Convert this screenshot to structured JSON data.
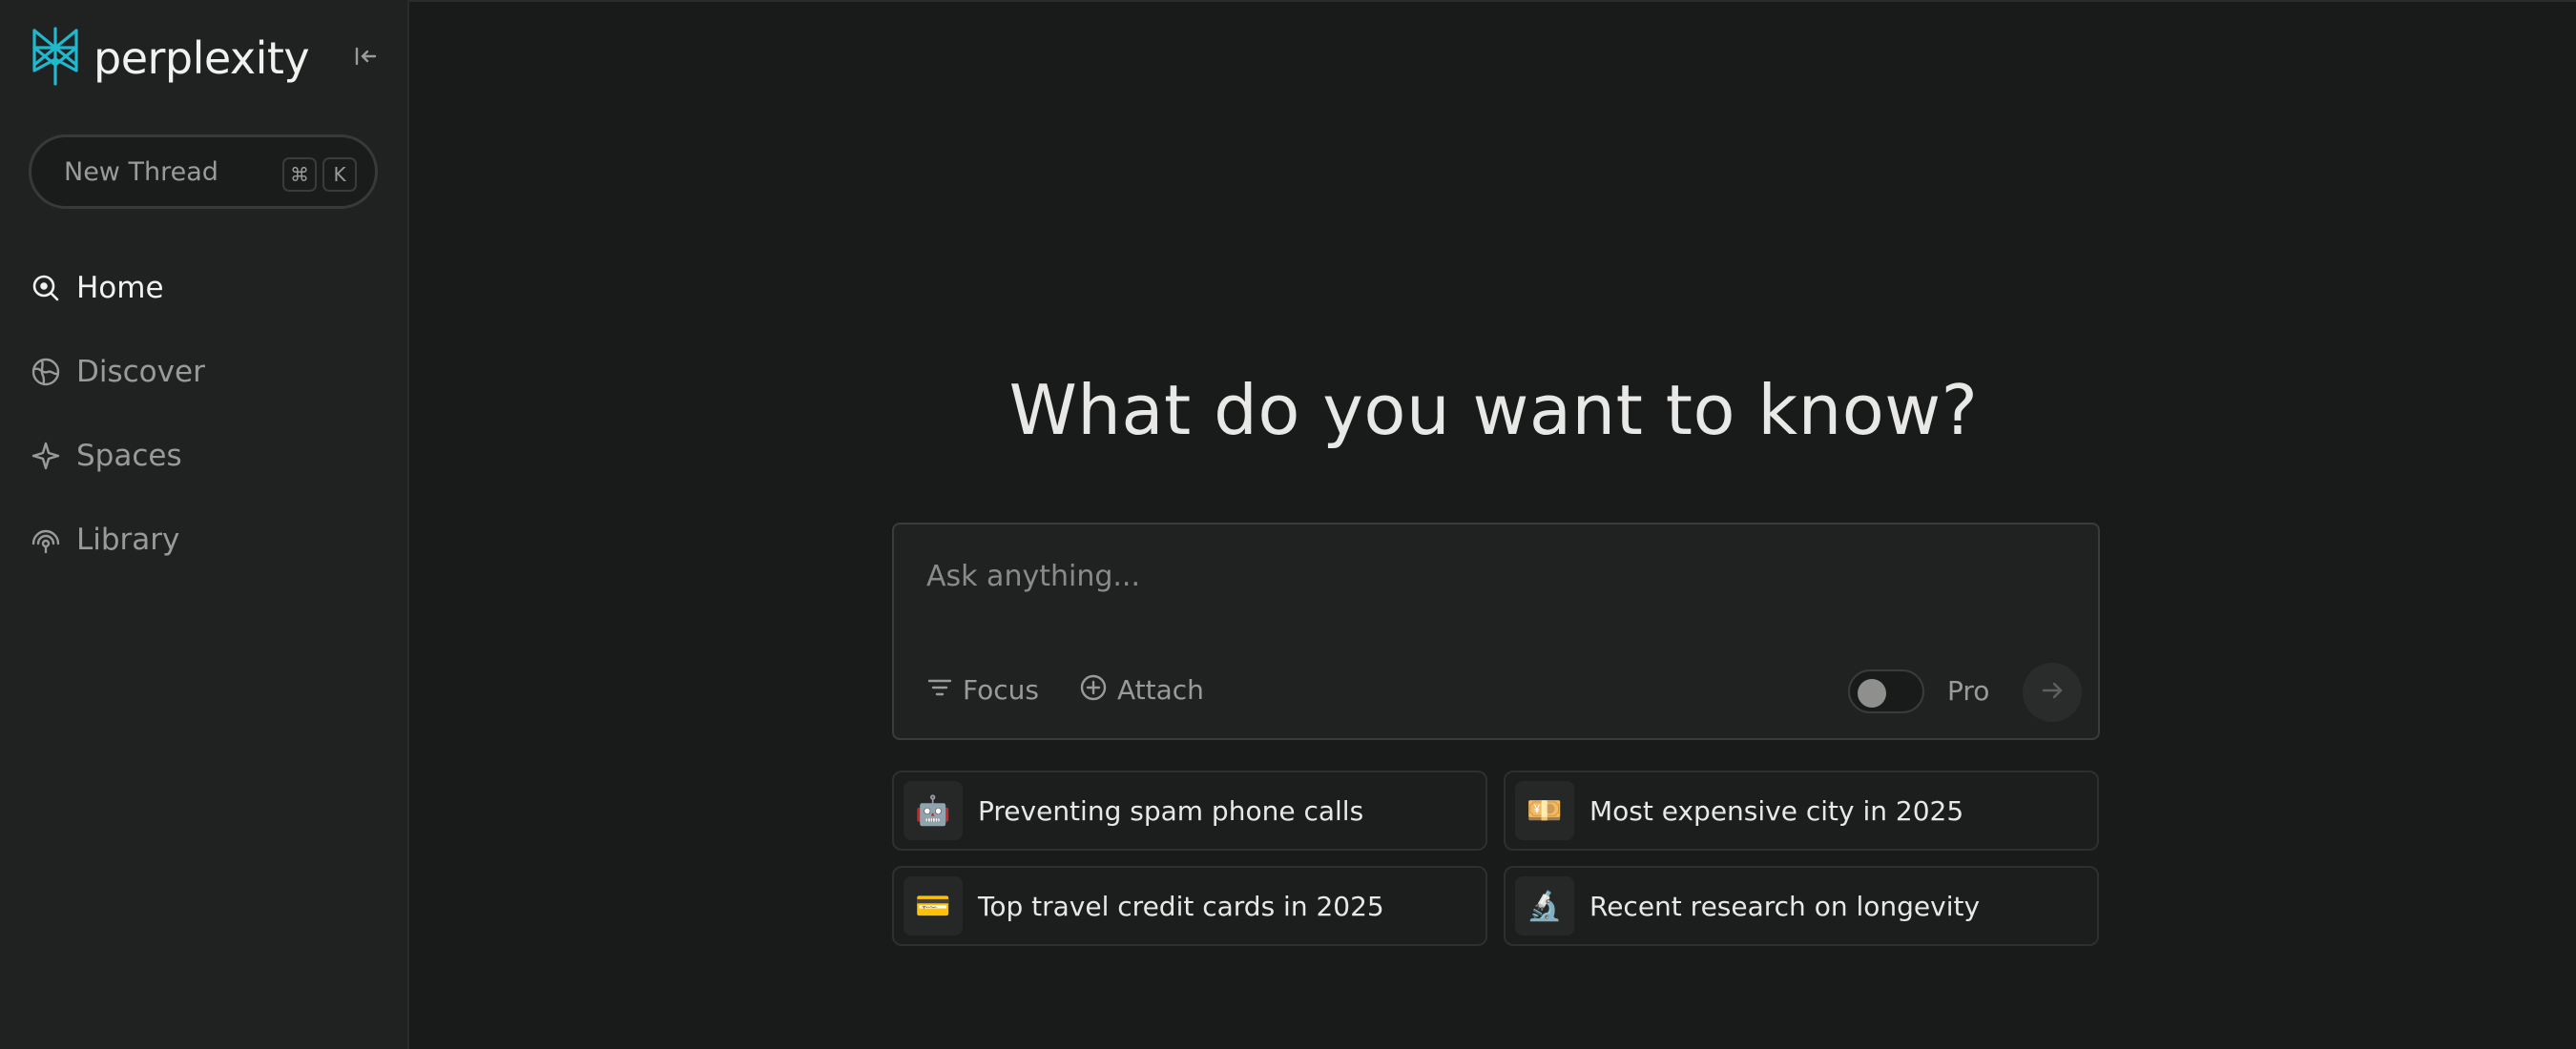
{
  "brand": {
    "name": "perplexity",
    "accent_color": "#20b8cd"
  },
  "sidebar": {
    "new_thread": {
      "label": "New Thread",
      "shortcut_cmd": "⌘",
      "shortcut_key": "K"
    },
    "items": [
      {
        "label": "Home",
        "icon": "home-search-icon",
        "active": true
      },
      {
        "label": "Discover",
        "icon": "globe-icon",
        "active": false
      },
      {
        "label": "Spaces",
        "icon": "sparkle-icon",
        "active": false
      },
      {
        "label": "Library",
        "icon": "library-icon",
        "active": false
      }
    ]
  },
  "main": {
    "heading": "What do you want to know?",
    "search": {
      "placeholder": "Ask anything...",
      "value": "",
      "focus_label": "Focus",
      "attach_label": "Attach",
      "pro_label": "Pro",
      "pro_enabled": false
    },
    "suggestions": [
      {
        "emoji": "🤖",
        "label": "Preventing spam phone calls"
      },
      {
        "emoji": "💴",
        "label": "Most expensive city in 2025"
      },
      {
        "emoji": "💳",
        "label": "Top travel credit cards in 2025"
      },
      {
        "emoji": "🔬",
        "label": "Recent research on longevity"
      }
    ]
  }
}
